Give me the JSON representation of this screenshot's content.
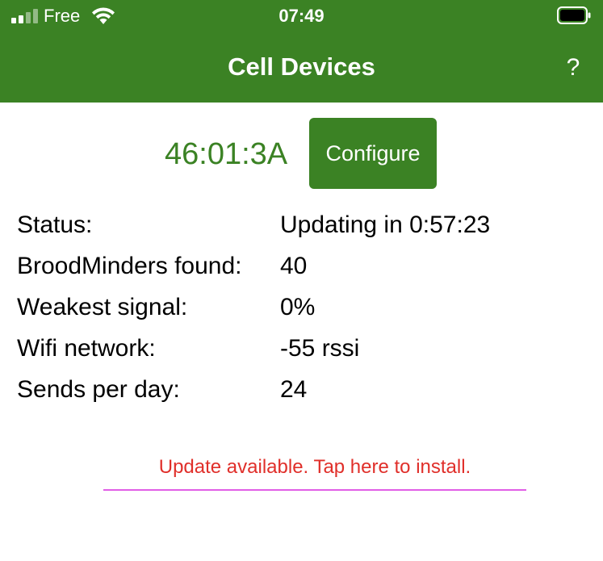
{
  "status_bar": {
    "carrier": "Free",
    "time": "07:49",
    "signal_icon": "cellular-signal-icon",
    "wifi_icon": "wifi-icon",
    "battery_icon": "battery-icon"
  },
  "header": {
    "title": "Cell Devices",
    "help_label": "?",
    "background_color": "#3b8224"
  },
  "device": {
    "id": "46:01:3A",
    "configure_label": "Configure",
    "accent_color": "#3b8224"
  },
  "info": {
    "rows": [
      {
        "label": "Status:",
        "value": "Updating in 0:57:23"
      },
      {
        "label": "BroodMinders found:",
        "value": "40"
      },
      {
        "label": "Weakest signal:",
        "value": "0%"
      },
      {
        "label": "Wifi network:",
        "value": "-55 rssi"
      },
      {
        "label": "Sends per day:",
        "value": "24"
      }
    ]
  },
  "update": {
    "text": "Update available. Tap here to install.",
    "text_color": "#e02f2a",
    "underline_color": "#e15ee6"
  }
}
